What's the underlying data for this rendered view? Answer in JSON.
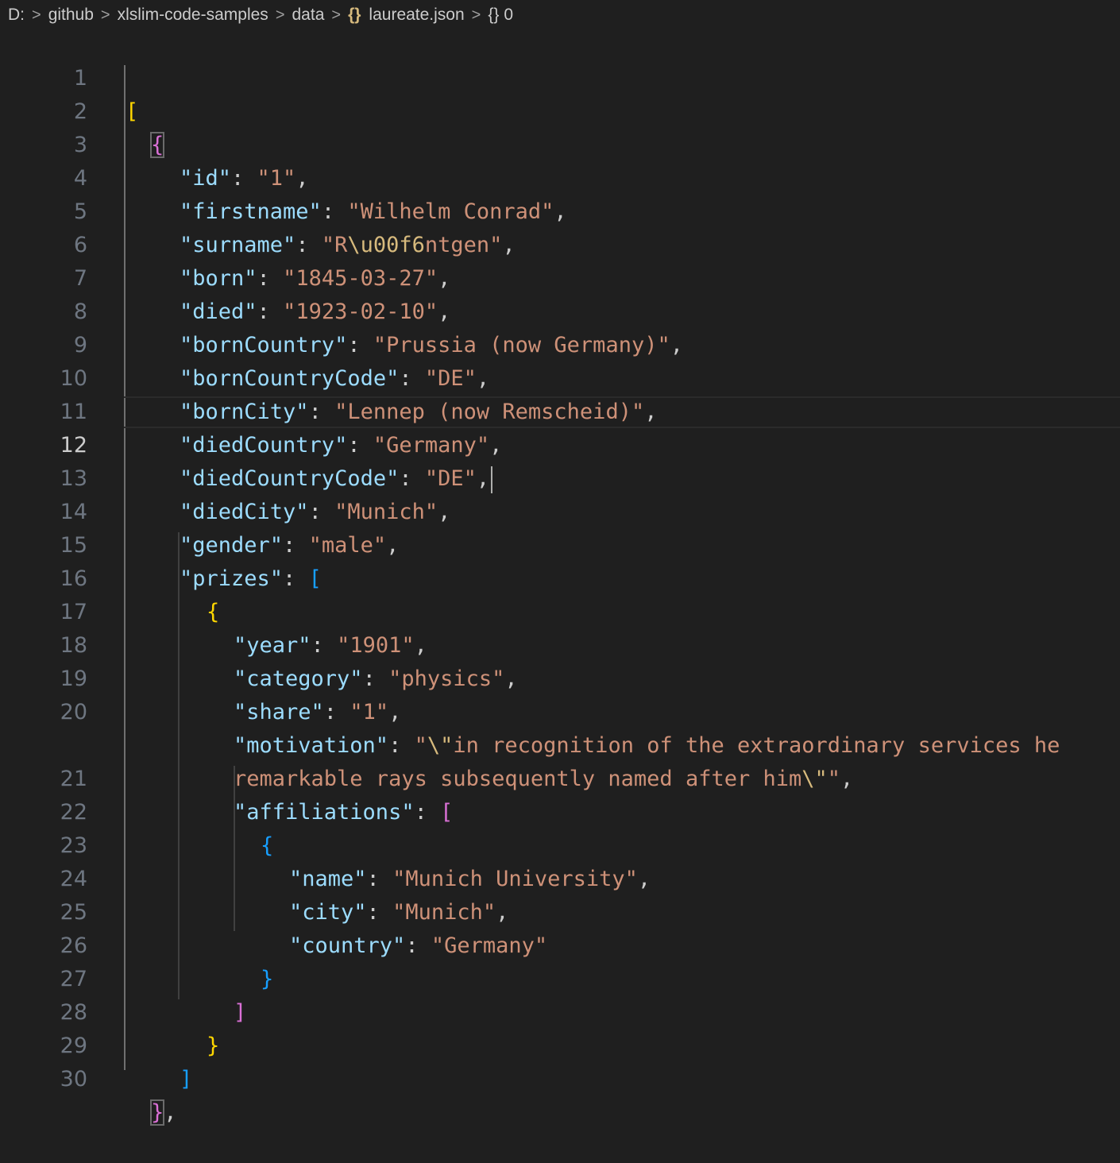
{
  "breadcrumb": {
    "items": [
      "D:",
      "github",
      "xlslim-code-samples",
      "data",
      "laureate.json",
      "0"
    ],
    "separator": ">",
    "file_icon": "json-braces-icon",
    "symbol_icon": "object-braces-icon"
  },
  "editor": {
    "active_line": 12,
    "colors": {
      "background": "#1f1f1f",
      "key": "#9cdcfe",
      "string": "#ce9178",
      "escape": "#d7ba7d",
      "bracket_level1": "#ffd700",
      "bracket_level2": "#da70d6",
      "bracket_level3": "#179fff"
    },
    "lines": [
      {
        "n": "1"
      },
      {
        "n": "2"
      },
      {
        "n": "3"
      },
      {
        "n": "4"
      },
      {
        "n": "5"
      },
      {
        "n": "6"
      },
      {
        "n": "7"
      },
      {
        "n": "8"
      },
      {
        "n": "9"
      },
      {
        "n": "10"
      },
      {
        "n": "11"
      },
      {
        "n": "12"
      },
      {
        "n": "13"
      },
      {
        "n": "14"
      },
      {
        "n": "15"
      },
      {
        "n": "16"
      },
      {
        "n": "17"
      },
      {
        "n": "18"
      },
      {
        "n": "19"
      },
      {
        "n": "20"
      },
      {
        "n": ""
      },
      {
        "n": "21"
      },
      {
        "n": "22"
      },
      {
        "n": "23"
      },
      {
        "n": "24"
      },
      {
        "n": "25"
      },
      {
        "n": "26"
      },
      {
        "n": "27"
      },
      {
        "n": "28"
      },
      {
        "n": "29"
      },
      {
        "n": "30"
      }
    ],
    "tokens": {
      "open_array": "[",
      "open_obj": "{",
      "close_obj": "}",
      "close_array": "]",
      "close_obj_comma": ",",
      "id_key": "\"id\"",
      "id_val": "\"1\"",
      "firstname_key": "\"firstname\"",
      "firstname_val": "\"Wilhelm Conrad\"",
      "surname_key": "\"surname\"",
      "surname_val_a": "\"R",
      "surname_val_esc": "\\u00f6",
      "surname_val_b": "ntgen\"",
      "born_key": "\"born\"",
      "born_val": "\"1845-03-27\"",
      "died_key": "\"died\"",
      "died_val": "\"1923-02-10\"",
      "bornCountry_key": "\"bornCountry\"",
      "bornCountry_val": "\"Prussia (now Germany)\"",
      "bornCountryCode_key": "\"bornCountryCode\"",
      "bornCountryCode_val": "\"DE\"",
      "bornCity_key": "\"bornCity\"",
      "bornCity_val": "\"Lennep (now Remscheid)\"",
      "diedCountry_key": "\"diedCountry\"",
      "diedCountry_val": "\"Germany\"",
      "diedCountryCode_key": "\"diedCountryCode\"",
      "diedCountryCode_val": "\"DE\"",
      "diedCity_key": "\"diedCity\"",
      "diedCity_val": "\"Munich\"",
      "gender_key": "\"gender\"",
      "gender_val": "\"male\"",
      "prizes_key": "\"prizes\"",
      "year_key": "\"year\"",
      "year_val": "\"1901\"",
      "category_key": "\"category\"",
      "category_val": "\"physics\"",
      "share_key": "\"share\"",
      "share_val": "\"1\"",
      "motivation_key": "\"motivation\"",
      "motivation_val_a": "\"",
      "motivation_esc1": "\\\"",
      "motivation_val_b": "in recognition of the extraordinary services he",
      "motivation_val_c": "remarkable rays subsequently named after him",
      "motivation_esc2": "\\\"",
      "motivation_val_d": "\"",
      "affiliations_key": "\"affiliations\"",
      "name_key": "\"name\"",
      "name_val": "\"Munich University\"",
      "city_key": "\"city\"",
      "city_val": "\"Munich\"",
      "country_key": "\"country\"",
      "country_val": "\"Germany\"",
      "colon": ": ",
      "comma": ","
    }
  }
}
